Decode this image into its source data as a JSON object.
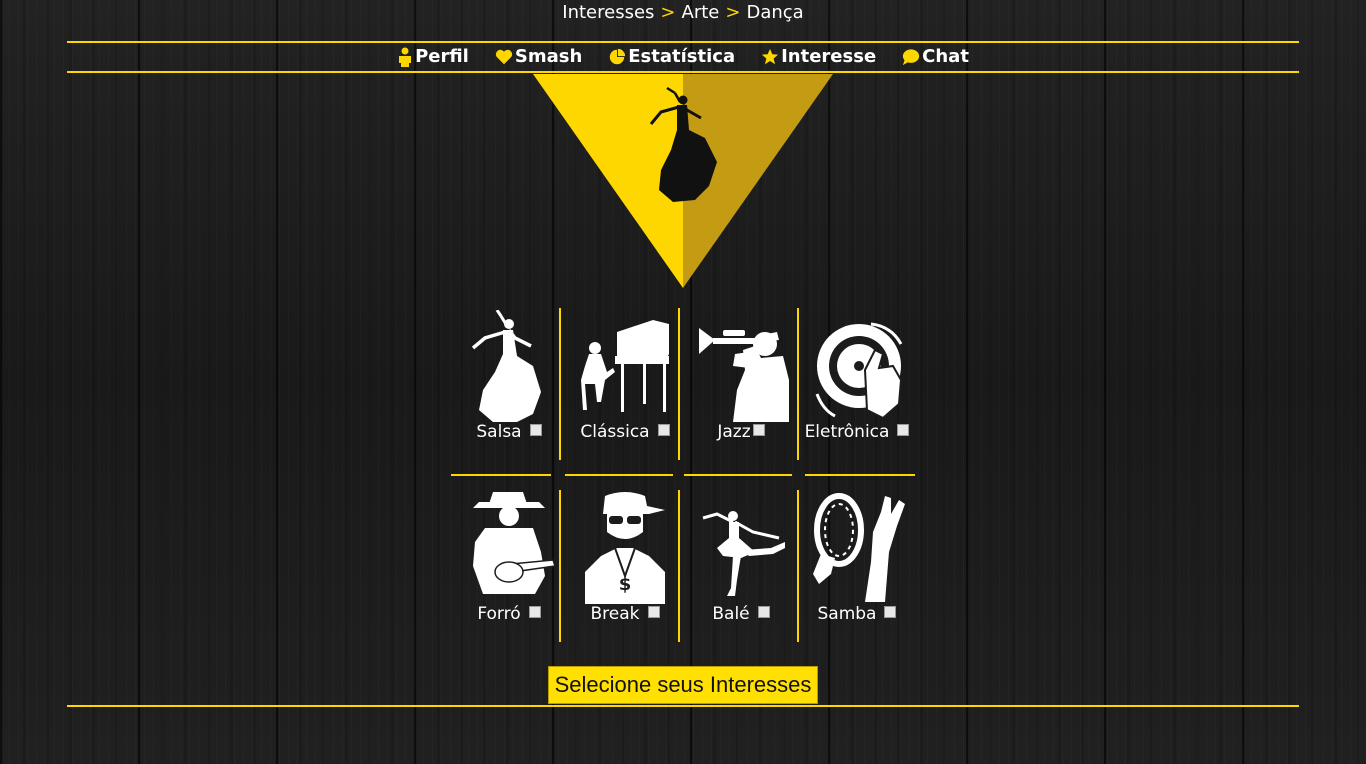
{
  "breadcrumb": {
    "items": [
      "Interesses",
      "Arte",
      "Dança"
    ],
    "separator": ">"
  },
  "nav": {
    "items": [
      {
        "label": "Perfil",
        "icon": "person-icon"
      },
      {
        "label": "Smash",
        "icon": "heart-icon"
      },
      {
        "label": "Estatística",
        "icon": "pie-chart-icon"
      },
      {
        "label": "Interesse",
        "icon": "star-icon"
      },
      {
        "label": "Chat",
        "icon": "chat-bubble-icon"
      }
    ]
  },
  "hero": {
    "icon": "flamenco-dancer-icon"
  },
  "interests": [
    {
      "label": "Salsa",
      "icon": "flamenco-dancer-icon",
      "checked": false
    },
    {
      "label": "Clássica",
      "icon": "piano-player-icon",
      "checked": false
    },
    {
      "label": "Jazz",
      "icon": "trumpet-player-icon",
      "checked": false
    },
    {
      "label": "Eletrônica",
      "icon": "dj-turntable-icon",
      "checked": false
    },
    {
      "label": "Forró",
      "icon": "cowboy-guitar-icon",
      "checked": false
    },
    {
      "label": "Break",
      "icon": "rapper-chain-icon",
      "checked": false
    },
    {
      "label": "Balé",
      "icon": "ballerina-icon",
      "checked": false
    },
    {
      "label": "Samba",
      "icon": "tambourine-hands-icon",
      "checked": false
    }
  ],
  "submit": {
    "label": "Selecione seus Interesses"
  },
  "colors": {
    "accent": "#ffd700",
    "accent_dark": "#c49c14",
    "text": "#ffffff",
    "background": "#1c1c1c"
  }
}
